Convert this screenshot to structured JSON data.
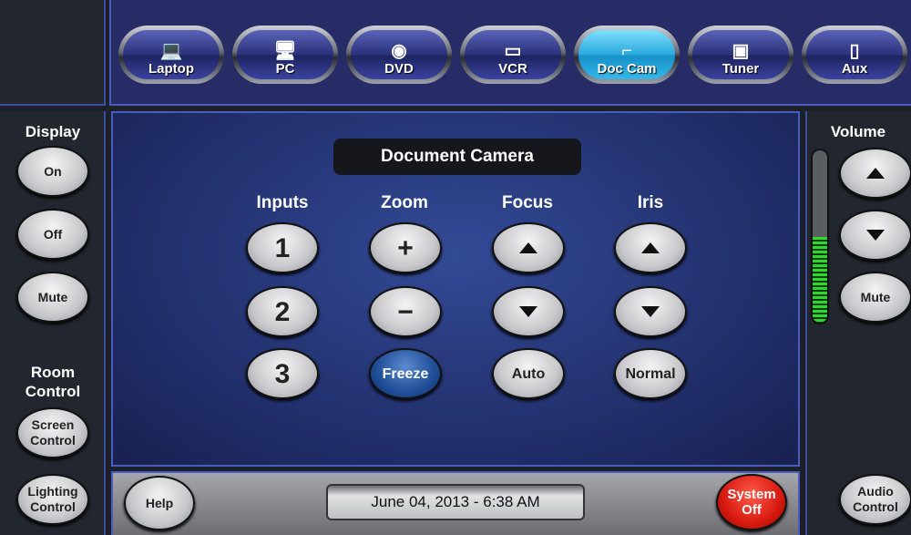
{
  "sources": [
    {
      "label": "Laptop",
      "icon": "laptop-icon",
      "glyph": "💻"
    },
    {
      "label": "PC",
      "icon": "desktop-pc-icon",
      "glyph": "🖥"
    },
    {
      "label": "DVD",
      "icon": "disc-icon",
      "glyph": "◉"
    },
    {
      "label": "VCR",
      "icon": "vcr-tape-icon",
      "glyph": "▭"
    },
    {
      "label": "Doc Cam",
      "icon": "document-camera-icon",
      "glyph": "⌐",
      "active": true
    },
    {
      "label": "Tuner",
      "icon": "tuner-icon",
      "glyph": "▣"
    },
    {
      "label": "Aux",
      "icon": "phone-icon",
      "glyph": "▯"
    }
  ],
  "left": {
    "display_title": "Display",
    "on": "On",
    "off": "Off",
    "mute": "Mute",
    "room_title": "Room\nControl",
    "screen": "Screen Control",
    "lighting": "Lighting Control"
  },
  "right": {
    "volume_title": "Volume",
    "mute": "Mute",
    "audio": "Audio Control",
    "volume_level_percent": 50
  },
  "main": {
    "title": "Document Camera",
    "inputs": "Inputs",
    "zoom": "Zoom",
    "focus": "Focus",
    "iris": "Iris",
    "input1": "1",
    "input2": "2",
    "input3": "3",
    "zoom_in": "+",
    "zoom_out": "−",
    "freeze": "Freeze",
    "auto": "Auto",
    "normal": "Normal"
  },
  "bottom": {
    "help": "Help",
    "datetime": "June 04, 2013  -  6:38 AM",
    "system_off": "System Off"
  },
  "colors": {
    "active_source": "#2aa8dc",
    "panel": "#273a82",
    "system_off": "#d81a10",
    "freeze": "#1f4d96",
    "meter": "#2ed82e"
  }
}
